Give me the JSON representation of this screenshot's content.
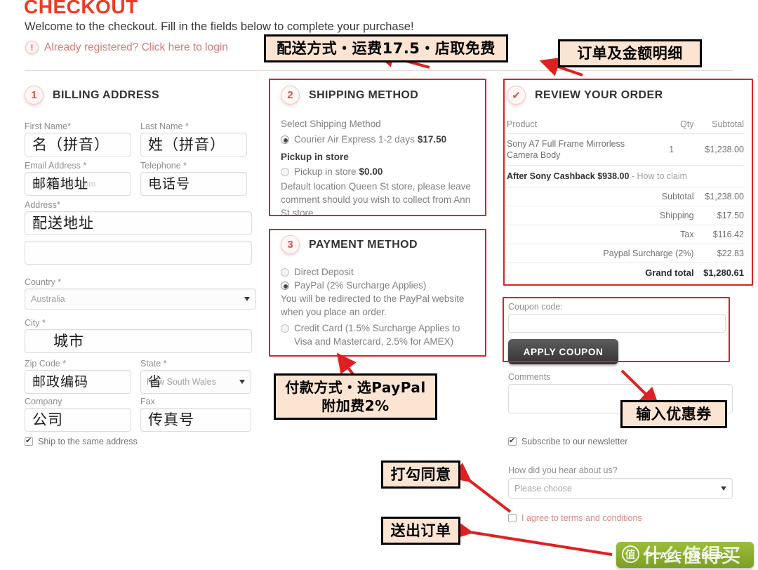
{
  "header": {
    "title": "CHECKOUT",
    "welcome": "Welcome to the checkout. Fill in the fields below to complete your purchase!",
    "login_icon": "exclamation-icon",
    "login_text": "Already registered? Click here to login"
  },
  "billing": {
    "step_number": "1",
    "title": "BILLING ADDRESS",
    "fields": [
      {
        "label": "First Name*",
        "value": "名（拼音）",
        "placeholder": ""
      },
      {
        "label": "Last Name *",
        "value": "姓（拼音）",
        "placeholder": ""
      },
      {
        "label": "Email Address *",
        "value": "邮箱地址",
        "placeholder": "your@email.com"
      },
      {
        "label": "Telephone *",
        "value": "电话号",
        "placeholder": ""
      },
      {
        "label": "Address*",
        "value": "配送地址",
        "placeholder": ""
      },
      {
        "label": "",
        "value": "",
        "placeholder": ""
      }
    ],
    "country_label": "Country *",
    "country_value": "Australia",
    "city_label": "City *",
    "city_value": "城市",
    "zip_label": "Zip Code *",
    "zip_value": "邮政编码",
    "state_label": "State *",
    "state_value": "New South Wales",
    "state_overlay": "省",
    "company_label": "Company",
    "company_value": "公司",
    "fax_label": "Fax",
    "fax_value": "传真号",
    "ship_same_label": "Ship to the same address",
    "ship_same_checked": true
  },
  "shipping": {
    "step_number": "2",
    "title": "SHIPPING METHOD",
    "select_label": "Select Shipping Method",
    "options": [
      {
        "label": "Courier Air Express 1-2 days",
        "price": "$17.50",
        "selected": true
      }
    ],
    "pickup_heading": "Pickup in store",
    "pickup_option": {
      "label": "Pickup in store",
      "price": "$0.00",
      "selected": false
    },
    "pickup_note": "Default location Queen St store, please leave comment should you wish to collect from Ann St store"
  },
  "payment": {
    "step_number": "3",
    "title": "PAYMENT METHOD",
    "options": [
      {
        "label": "Direct Deposit",
        "selected": false
      },
      {
        "label": "PayPal (2% Surcharge Applies)",
        "selected": true
      },
      {
        "label": "Credit Card (1.5% Surcharge Applies to Visa and Mastercard, 2.5% for AMEX)",
        "selected": false
      }
    ],
    "paypal_note": "You will be redirected to the PayPal website when you place an order."
  },
  "review": {
    "step_icon": "check-icon",
    "title": "REVIEW YOUR ORDER",
    "columns": [
      "Product",
      "Qty",
      "Subtotal"
    ],
    "items": [
      {
        "product": "Sony A7 Full Frame Mirrorless Camera Body",
        "qty": "1",
        "subtotal": "$1,238.00"
      }
    ],
    "cashback_label": "After Sony Cashback",
    "cashback_amount": "$938.00",
    "cashback_link": "- How to claim",
    "totals": [
      {
        "label": "Subtotal",
        "value": "$1,238.00"
      },
      {
        "label": "Shipping",
        "value": "$17.50"
      },
      {
        "label": "Tax",
        "value": "$116.42"
      },
      {
        "label": "Paypal Surcharge (2%)",
        "value": "$22.83"
      }
    ],
    "grand_label": "Grand total",
    "grand_value": "$1,280.61"
  },
  "coupon": {
    "label": "Coupon code:",
    "value": "",
    "button": "APPLY COUPON"
  },
  "comments": {
    "label": "Comments",
    "value": ""
  },
  "newsletter": {
    "label": "Subscribe to our newsletter",
    "checked": true
  },
  "hear_about": {
    "label": "How did you hear about us?",
    "value": "Please choose"
  },
  "terms": {
    "label": "I agree to terms and conditions",
    "checked": false
  },
  "place_order": {
    "label": "PLACE ORDER",
    "watermark_badge": "值",
    "watermark_text": "什么值得买"
  },
  "annotations": [
    {
      "name": "shipping-note",
      "text": "配送方式・运费17.5・店取免费"
    },
    {
      "name": "order-note",
      "text": "订单及金额明细"
    },
    {
      "name": "payment-note",
      "text": "付款方式・选PayPal\n附加费2%"
    },
    {
      "name": "coupon-note",
      "text": "输入优惠券"
    },
    {
      "name": "agree-note",
      "text": "打勾同意"
    },
    {
      "name": "submit-note",
      "text": "送出订单"
    }
  ],
  "colors": {
    "title_red": "#ee3b24",
    "annotation_red": "#e02020",
    "annotation_bg": "#fbe4d2",
    "place_order_green": "#8cae32"
  }
}
